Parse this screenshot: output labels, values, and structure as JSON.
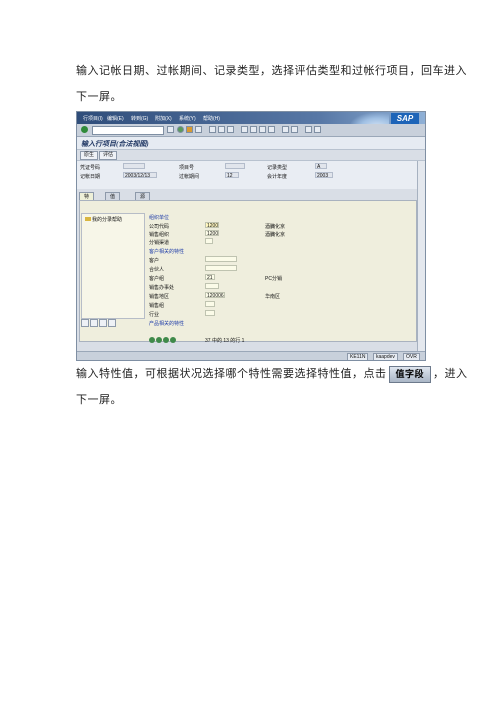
{
  "doc": {
    "p1": "输入记帐日期、过帐期间、记录类型，选择评估类型和过帐行项目，回车进入",
    "p2": "下一屏。",
    "p3a": "输入特性值，可根据状况选择哪个特性需要选择特性值，点击",
    "p3_button": "值字段",
    "p3b": "，进入",
    "p4": "下一屏。"
  },
  "sap": {
    "menu": [
      "行项目(I)",
      "编辑(E)",
      "转到(G)",
      "附加(X)",
      "系统(Y)",
      "帮助(H)"
    ],
    "logo": "SAP",
    "title": "输入行项目(合法视图)",
    "app_buttons": [
      "原生",
      "评估"
    ],
    "header": {
      "doc_no_label": "凭证号码",
      "item_no_label": "项目号",
      "record_type_label": "记录类型",
      "record_type_value": "A",
      "posting_date_label": "记帐日期",
      "posting_date_value": "2003/12/13",
      "period_label": "过帐期间",
      "period_value": "12",
      "fiscal_year_label": "会计年度",
      "fiscal_year_value": "2003"
    },
    "tabs": [
      "特性",
      "值字段",
      "源数据"
    ],
    "tree_item": "我的分录帮助",
    "groups": {
      "org": "组织单位",
      "customer": "客户相关的特性",
      "product": "产品相关的特性"
    },
    "fields": [
      {
        "label": "公司代码",
        "value": "1200",
        "desc": "酒臓化京"
      },
      {
        "label": "销售组织",
        "value": "1200",
        "desc": "酒臓化京"
      },
      {
        "label": "分销渠道",
        "value": "",
        "desc": ""
      },
      {
        "label": "客户",
        "value": "",
        "desc": ""
      },
      {
        "label": "合伙人",
        "value": "",
        "desc": ""
      },
      {
        "label": "客户组",
        "value": "21",
        "desc": "PC分销"
      },
      {
        "label": "销售办事处",
        "value": "",
        "desc": ""
      },
      {
        "label": "销售地区",
        "value": "120006",
        "desc": "华南区"
      },
      {
        "label": "销售组",
        "value": "",
        "desc": ""
      },
      {
        "label": "行业",
        "value": "",
        "desc": ""
      }
    ],
    "entries": "37 中的 13 的行 1",
    "status": [
      "KE11N",
      "kaapdev",
      "OVR"
    ]
  }
}
